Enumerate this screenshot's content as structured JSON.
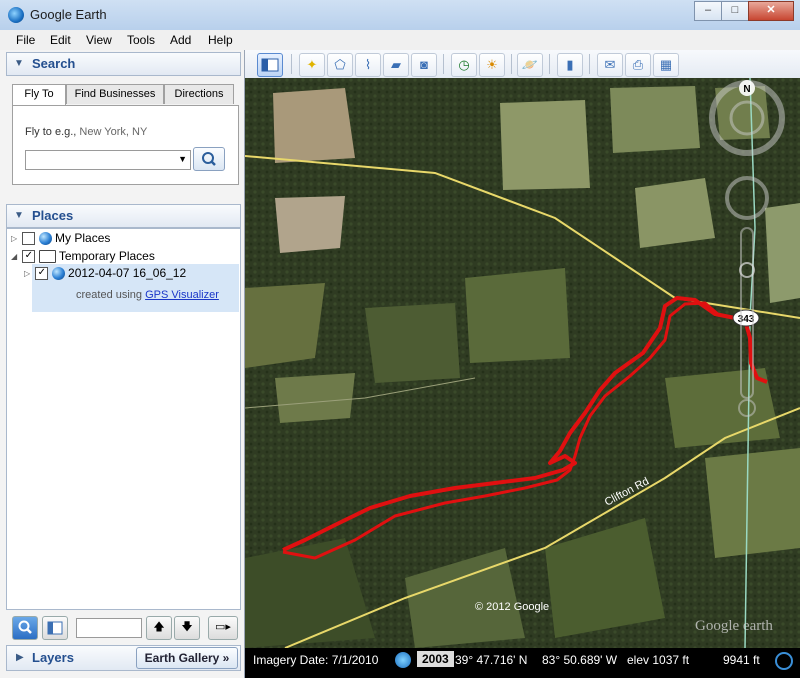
{
  "window": {
    "title": "Google Earth"
  },
  "menu": [
    "File",
    "Edit",
    "View",
    "Tools",
    "Add",
    "Help"
  ],
  "search": {
    "header": "Search",
    "tabs": [
      "Fly To",
      "Find Businesses",
      "Directions"
    ],
    "flyto_label": "Fly to e.g.,",
    "flyto_example": "New York, NY",
    "input_value": ""
  },
  "places": {
    "header": "Places",
    "items": [
      {
        "label": "My Places",
        "checked": false
      },
      {
        "label": "Temporary Places",
        "checked": true
      },
      {
        "label": "2012-04-07 16_06_12",
        "checked": true
      },
      {
        "desc_prefix": "created using",
        "link": "GPS Visualizer"
      }
    ]
  },
  "layers": {
    "header": "Layers",
    "gallery_button": "Earth Gallery »"
  },
  "map": {
    "road_label": "Clifton Rd",
    "route_shield": "343",
    "copyright": "© 2012 Google",
    "watermark": "Google earth",
    "compass": "N"
  },
  "status": {
    "imagery_date": "Imagery Date: 7/1/2010",
    "year": "2003",
    "lat": "39° 47.716' N",
    "lon": "83° 50.689' W",
    "elev": "elev  1037 ft",
    "eye_alt": "9941 ft"
  },
  "colors": {
    "track": "#e01010",
    "road": "#e8d86a",
    "accent": "#244f8f"
  }
}
